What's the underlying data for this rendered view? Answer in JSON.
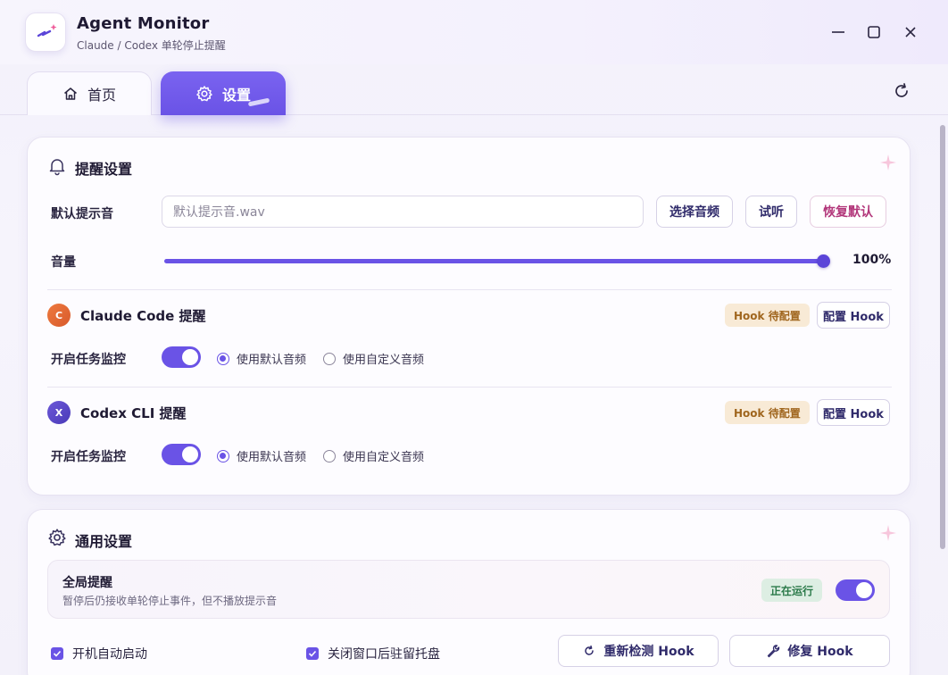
{
  "app": {
    "title": "Agent Monitor",
    "subtitle": "Claude / Codex 单轮停止提醒"
  },
  "tabs": [
    {
      "label": "首页",
      "icon": "home-icon",
      "active": false
    },
    {
      "label": "设置",
      "icon": "gear-icon",
      "active": true
    }
  ],
  "reminder": {
    "title": "提醒设置",
    "default_sound_label": "默认提示音",
    "default_sound_value": "默认提示音.wav",
    "choose_audio": "选择音频",
    "preview": "试听",
    "restore_default": "恢复默认",
    "volume_label": "音量",
    "volume_value": "100%",
    "volume_level": 1.0
  },
  "agents": [
    {
      "badge": "C",
      "title": "Claude Code 提醒",
      "status": "Hook 待配置",
      "config_button": "配置 Hook",
      "monitor_label": "开启任务监控",
      "monitor_on": true,
      "radio_default": "使用默认音频",
      "radio_custom": "使用自定义音频",
      "selected": "default"
    },
    {
      "badge": "X",
      "title": "Codex CLI 提醒",
      "status": "Hook 待配置",
      "config_button": "配置 Hook",
      "monitor_label": "开启任务监控",
      "monitor_on": true,
      "radio_default": "使用默认音频",
      "radio_custom": "使用自定义音频",
      "selected": "default"
    }
  ],
  "general": {
    "title": "通用设置",
    "global_title": "全局提醒",
    "global_desc": "暂停后仍接收单轮停止事件，但不播放提示音",
    "global_status": "正在运行",
    "global_on": true,
    "autostart": "开机自动启动",
    "autostart_checked": true,
    "tray": "关闭窗口后驻留托盘",
    "tray_checked": true,
    "recheck_hook": "重新检测 Hook",
    "repair_hook": "修复 Hook"
  },
  "colors": {
    "accent": "#6a53e6",
    "pending_bg": "#f8ead6",
    "pending_fg": "#a0661e",
    "running_bg": "#ddeee3",
    "running_fg": "#2b7a4a",
    "claude_badge": "#e46a34",
    "codex_badge": "#5a48c8"
  }
}
